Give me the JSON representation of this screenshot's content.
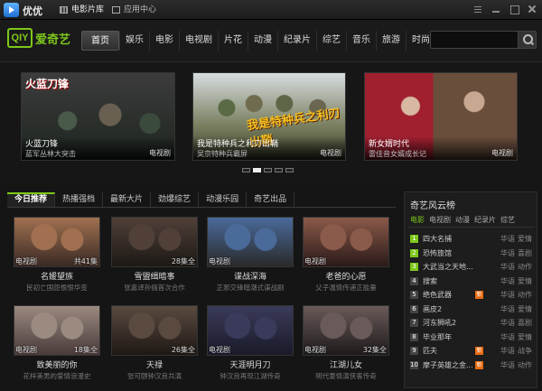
{
  "titlebar": {
    "app_name": "优优",
    "tabs": [
      {
        "label": "电影片库",
        "active": true
      },
      {
        "label": "应用中心",
        "active": false
      }
    ]
  },
  "header": {
    "brand": {
      "box": "QIY",
      "text": "爱奇艺"
    },
    "nav": [
      "首页",
      "娱乐",
      "电影",
      "电视剧",
      "片花",
      "动漫",
      "纪录片",
      "综艺",
      "音乐",
      "旅游",
      "时尚"
    ],
    "active_nav": 0,
    "search": {
      "placeholder": ""
    }
  },
  "banner": {
    "slides": [
      {
        "logo": "火蓝刀锋",
        "deco": "",
        "title": "火蓝刀锋",
        "subtitle": "蓝军丛林大突击",
        "tag": "电视剧"
      },
      {
        "logo": "",
        "deco": "我是特种兵之利刃出鞘",
        "title": "我是特种兵之利刃出鞘",
        "subtitle": "吴京特种兵霸屏",
        "tag": "电视剧"
      },
      {
        "logo": "",
        "deco": "",
        "title": "新女婿时代",
        "subtitle": "雷佳音女婿成长记",
        "tag": "电视剧"
      }
    ],
    "active_dot": 1,
    "dot_count": 5
  },
  "tabs": [
    "今日推荐",
    "热播强档",
    "最新大片",
    "劲爆综艺",
    "动漫乐园",
    "奇艺出品"
  ],
  "active_tab": 0,
  "videos": [
    {
      "title": "名媛望族",
      "sub": "民初亡国怨恨恨华变",
      "badge_left": "电视剧",
      "badge_right": "共41集",
      "colors": [
        "#a07050",
        "#3a2a24"
      ]
    },
    {
      "title": "雪盟缉暗事",
      "sub": "张嘉译孙俪首次合作",
      "badge_left": "",
      "badge_right": "28集全",
      "colors": [
        "#504038",
        "#1c1814"
      ]
    },
    {
      "title": "谍战深海",
      "sub": "正邪交锋暗潮式谍战剧",
      "badge_left": "电视剧",
      "badge_right": "",
      "colors": [
        "#4a6a9a",
        "#2a2a2a"
      ]
    },
    {
      "title": "老爸的心愿",
      "sub": "父子温情传递正能量",
      "badge_left": "电视剧",
      "badge_right": "",
      "colors": [
        "#8a5a4a",
        "#2a1a18"
      ]
    },
    {
      "title": "致美丽的你",
      "sub": "花样美男的爱情浪漫史",
      "badge_left": "电视剧",
      "badge_right": "18集全",
      "colors": [
        "#9a8a80",
        "#4a3a3a"
      ]
    },
    {
      "title": "天禄",
      "sub": "张可颐钟汉良共演",
      "badge_left": "",
      "badge_right": "26集全",
      "colors": [
        "#5a4a40",
        "#1e1814"
      ]
    },
    {
      "title": "天涯明月刀",
      "sub": "钟汉良再现江湖传奇",
      "badge_left": "电视剧",
      "badge_right": "",
      "colors": [
        "#3a3a5a",
        "#1a1a2a"
      ]
    },
    {
      "title": "江湖儿女",
      "sub": "明代豪情演侠客传奇",
      "badge_left": "电视剧",
      "badge_right": "32集全",
      "colors": [
        "#6a5a5a",
        "#1e1a1a"
      ]
    }
  ],
  "ranking": {
    "title": "奇艺风云榜",
    "tabs": [
      "电影",
      "电视剧",
      "动漫",
      "纪录片",
      "综艺"
    ],
    "active_tab": 0,
    "items": [
      {
        "rank": "1",
        "name": "四大名捕",
        "hot": false,
        "lang": "华语",
        "genre": "爱情"
      },
      {
        "rank": "2",
        "name": "恐怖旅馆",
        "hot": false,
        "lang": "华语",
        "genre": "喜剧"
      },
      {
        "rank": "3",
        "name": "大武当之天地...",
        "hot": false,
        "lang": "华语",
        "genre": "动作"
      },
      {
        "rank": "4",
        "name": "搜索",
        "hot": false,
        "lang": "华语",
        "genre": "爱情"
      },
      {
        "rank": "5",
        "name": "绝色武器",
        "hot": true,
        "lang": "华语",
        "genre": "动作"
      },
      {
        "rank": "6",
        "name": "画皮2",
        "hot": false,
        "lang": "华语",
        "genre": "爱情"
      },
      {
        "rank": "7",
        "name": "河东狮吼2",
        "hot": false,
        "lang": "华语",
        "genre": "喜剧"
      },
      {
        "rank": "8",
        "name": "毕业那年",
        "hot": false,
        "lang": "华语",
        "genre": "爱情"
      },
      {
        "rank": "9",
        "name": "匹夫",
        "hot": true,
        "lang": "华语",
        "genre": "战争"
      },
      {
        "rank": "10",
        "name": "摩子英雄之金...",
        "hot": true,
        "lang": "华语",
        "genre": "动作"
      }
    ],
    "hot_label": "新"
  }
}
